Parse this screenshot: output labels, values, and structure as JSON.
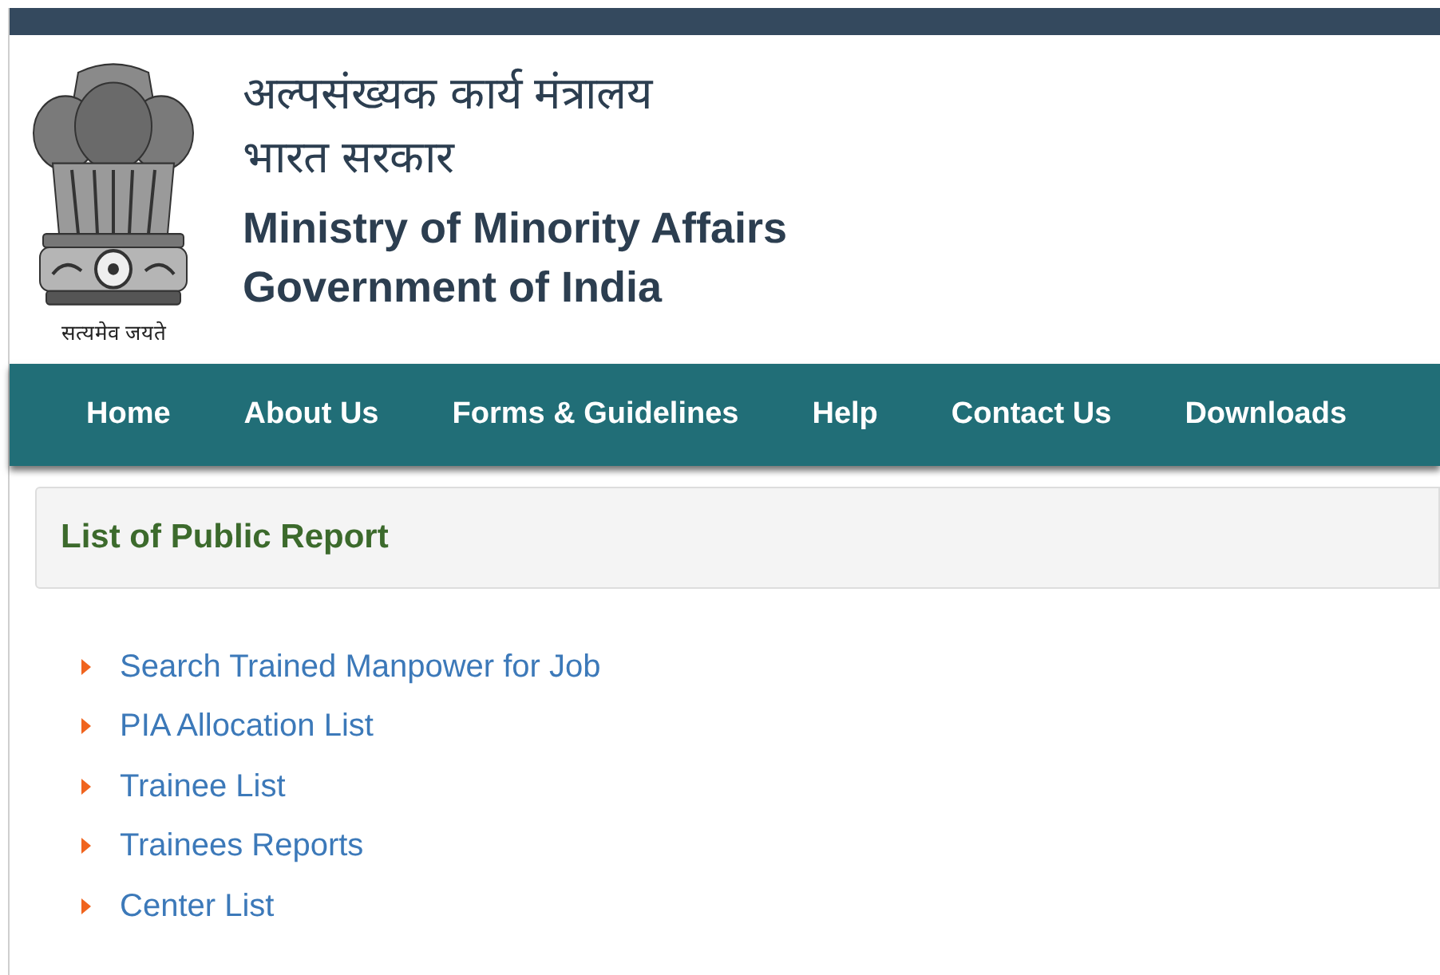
{
  "header": {
    "emblem_caption": "सत्यमेव जयते",
    "hindi_title_lines": [
      "अल्पसंख्यक कार्य मंत्रालय",
      "भारत सरकार"
    ],
    "english_title_lines": [
      "Ministry of Minority Affairs",
      "Government of India"
    ]
  },
  "nav": {
    "items": [
      {
        "label": "Home"
      },
      {
        "label": "About Us"
      },
      {
        "label": "Forms & Guidelines"
      },
      {
        "label": "Help"
      },
      {
        "label": "Contact Us"
      },
      {
        "label": "Downloads"
      }
    ]
  },
  "panel": {
    "title": "List of Public Report"
  },
  "report_links": [
    {
      "label": "Search Trained Manpower for Job"
    },
    {
      "label": "PIA Allocation List"
    },
    {
      "label": "Trainee List"
    },
    {
      "label": "Trainees Reports"
    },
    {
      "label": "Center List"
    }
  ]
}
